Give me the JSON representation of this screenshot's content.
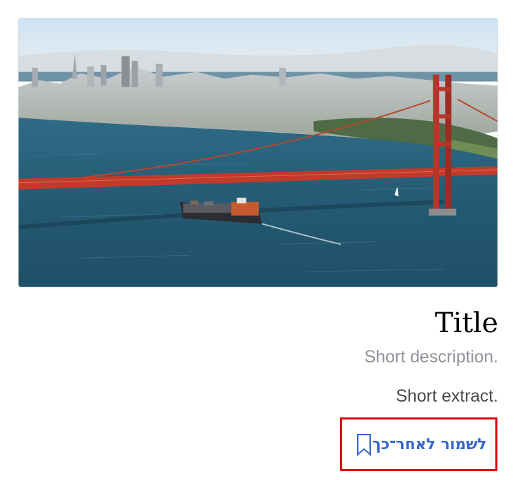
{
  "card": {
    "image": {
      "alt": ""
    },
    "title": "Title",
    "description": "Short description.",
    "extract": "Short extract.",
    "save_button": {
      "label": "לשמור לאחר־כך",
      "icon": "bookmark-icon"
    }
  },
  "colors": {
    "title": "#000000",
    "description": "#8f9399",
    "extract": "#4a4a4a",
    "link": "#3366cc",
    "highlight_border": "#e0000a"
  }
}
